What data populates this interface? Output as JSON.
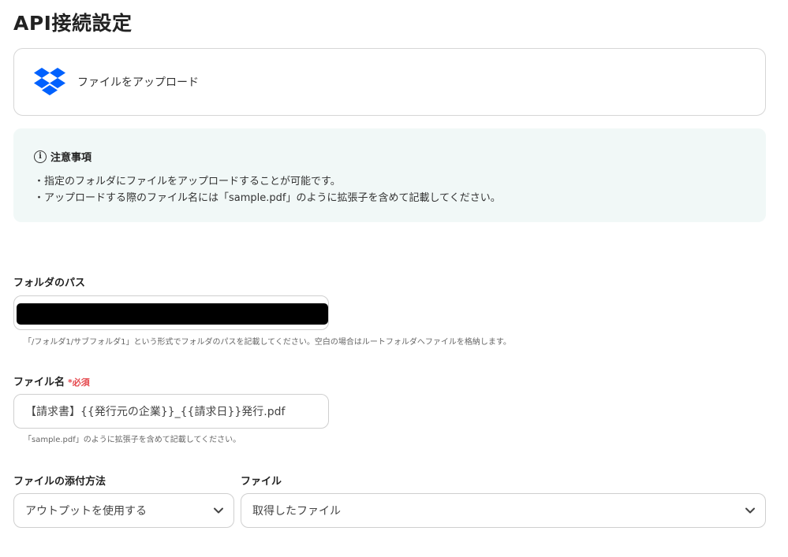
{
  "page": {
    "title": "API接続設定"
  },
  "app": {
    "action_label": "ファイルをアップロード",
    "icon": "dropbox-icon",
    "brand_color": "#0061fe"
  },
  "notice": {
    "icon": "info-icon",
    "title": "注意事項",
    "lines": [
      "・指定のフォルダにファイルをアップロードすることが可能です。",
      "・アップロードする際のファイル名には「sample.pdf」のように拡張子を含めて記載してください。"
    ],
    "background": "#f1f8f7"
  },
  "folder_path": {
    "label": "フォルダのパス",
    "value_redacted": true,
    "hint": "「/フォルダ1/サブフォルダ1」という形式でフォルダのパスを記載してください。空白の場合はルートフォルダへファイルを格納します。"
  },
  "file_name": {
    "label": "ファイル名",
    "required_label": "必須",
    "required_mark": "*",
    "value": "【請求書】{{発行元の企業}}_{{請求日}}発行.pdf",
    "hint": "「sample.pdf」のように拡張子を含めて記載してください。"
  },
  "attach_method": {
    "label": "ファイルの添付方法",
    "selected": "アウトプットを使用する"
  },
  "file": {
    "label": "ファイル",
    "selected": "取得したファイル"
  },
  "colors": {
    "required": "#e5484d",
    "input_border": "#cfcfcf"
  }
}
